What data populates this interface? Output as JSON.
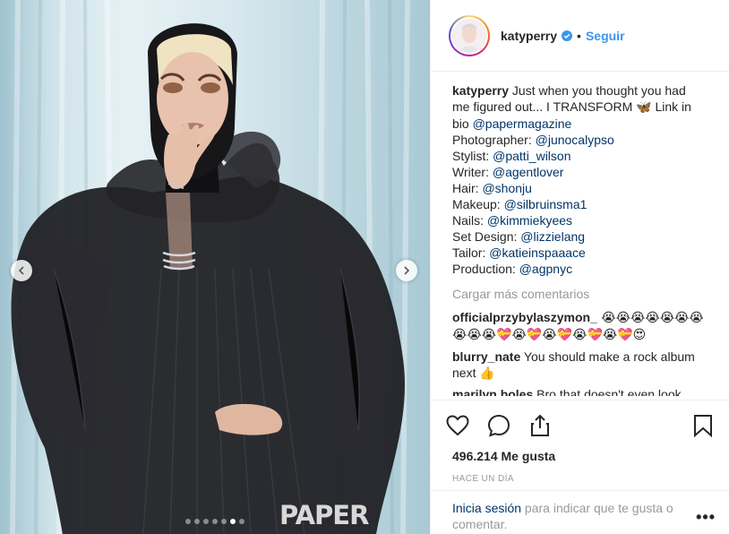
{
  "header": {
    "username": "katyperry",
    "separator": "•",
    "follow_label": "Seguir"
  },
  "caption": {
    "user": "katyperry",
    "text1": " Just when you thought you had",
    "text2": "me figured out... I TRANSFORM ",
    "butterfly": "🦋",
    "text2b": " Link in",
    "text3": "bio ",
    "mention": "@papermagazine",
    "credits": [
      {
        "label": "Photographer: ",
        "handle": "@junocalypso"
      },
      {
        "label": "Stylist: ",
        "handle": "@patti_wilson"
      },
      {
        "label": "Writer: ",
        "handle": "@agentlover"
      },
      {
        "label": "Hair: ",
        "handle": "@shonju"
      },
      {
        "label": "Makeup: ",
        "handle": "@silbruinsma1"
      },
      {
        "label": "Nails: ",
        "handle": "@kimmiekyees"
      },
      {
        "label": "Set Design: ",
        "handle": "@lizzielang"
      },
      {
        "label": "Tailor: ",
        "handle": "@katieinspaaace"
      },
      {
        "label": "Production: ",
        "handle": "@agpnyc"
      }
    ]
  },
  "load_more": "Cargar más comentarios",
  "comments": [
    {
      "user": "officialprzybylaszymon_",
      "text": " 😭😭😭😭😭😭😭😭😭😭💝😭💝😭💝😭💝😭💝😍"
    },
    {
      "user": "blurry_nate",
      "text": " You should make a rock album next 👍"
    },
    {
      "user": "marilyn.boles",
      "text": " Bro that doesn't even look"
    }
  ],
  "likes": "496.214 Me gusta",
  "timestamp": "HACE UN DÍA",
  "login": {
    "link": "Inicia sesión",
    "text": " para indicar que te gusta o comentar."
  },
  "more_menu": "•••",
  "watermark": "PAPER",
  "carousel": {
    "count": 7,
    "active": 5
  },
  "colors": {
    "accent": "#3897f0",
    "link": "#003569",
    "muted": "#999999"
  }
}
